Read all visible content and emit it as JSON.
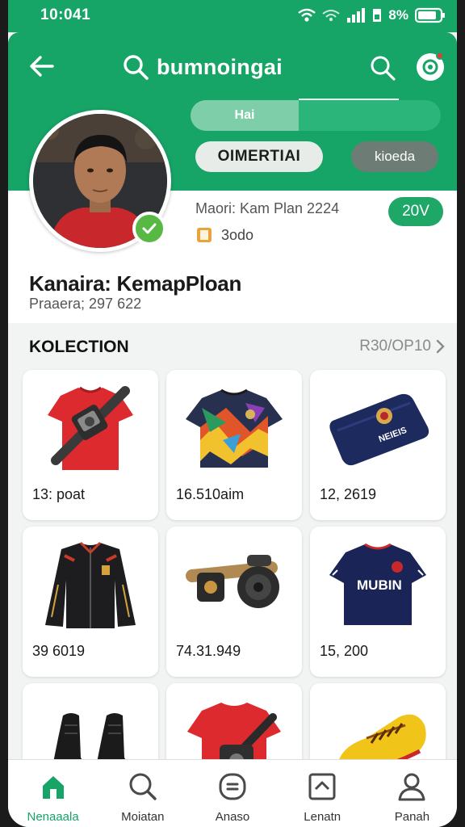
{
  "status_bar": {
    "time": "10:041",
    "battery": "8%"
  },
  "header": {
    "search_title": "bumnoingai",
    "segment": {
      "tab_active": "Hai",
      "tab_inactive": ""
    },
    "primary_button": "OIMERTIAI",
    "secondary_button": "kioeda"
  },
  "profile": {
    "member_since": "Maori: Kam Plan 2224",
    "meta_value": "3odo",
    "points": "20V",
    "name": "Kanaira: KemapPloan",
    "subtitle": "Praaera; 297 622"
  },
  "collection": {
    "title": "KOLECTION",
    "link": "R30/OP10",
    "items": [
      {
        "price": "13: poat",
        "icon": "red-shirt-with-camera"
      },
      {
        "price": "16.510aim",
        "icon": "multicolor-jersey"
      },
      {
        "price": "12, 2619",
        "icon": "navy-wallet"
      },
      {
        "price": "39 6019",
        "icon": "black-jacket"
      },
      {
        "price": "74.31.949",
        "icon": "camera-strap"
      },
      {
        "price": "15, 200",
        "icon": "navy-jersey"
      },
      {
        "price": "",
        "icon": "black-boots"
      },
      {
        "price": "",
        "icon": "red-shirt-with-bag"
      },
      {
        "price": "",
        "icon": "yellow-sneaker"
      }
    ],
    "jersey_text": "MUBIN",
    "wallet_text": "NEIEIS"
  },
  "bottom_nav": [
    {
      "label": "Nenaaala",
      "icon": "home-icon",
      "active": true
    },
    {
      "label": "Moiatan",
      "icon": "search-icon",
      "active": false
    },
    {
      "label": "Anaso",
      "icon": "chat-icon",
      "active": false
    },
    {
      "label": "Lenatn",
      "icon": "up-box-icon",
      "active": false
    },
    {
      "label": "Panah",
      "icon": "profile-icon",
      "active": false
    }
  ],
  "colors": {
    "brand_green": "#17a467",
    "badge_green": "#57b944",
    "surface": "#f2f3f3"
  }
}
